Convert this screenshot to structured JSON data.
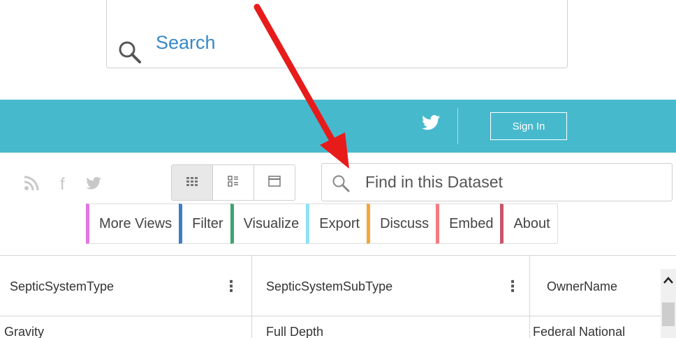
{
  "search": {
    "label": "Search"
  },
  "header": {
    "signin_label": "Sign In"
  },
  "find": {
    "label": "Find in this Dataset"
  },
  "tabs": [
    {
      "label": "More Views",
      "color": "#e276e2"
    },
    {
      "label": "Filter",
      "color": "#3a7fc5"
    },
    {
      "label": "Visualize",
      "color": "#3aa572"
    },
    {
      "label": "Export",
      "color": "#8fe1f4"
    },
    {
      "label": "Discuss",
      "color": "#f7a53b"
    },
    {
      "label": "Embed",
      "color": "#f47a82"
    },
    {
      "label": "About",
      "color": "#c7546a"
    }
  ],
  "table": {
    "columns": [
      "SepticSystemType",
      "SepticSystemSubType",
      "OwnerName"
    ],
    "rows": [
      [
        "Gravity",
        "Full Depth",
        "Federal National"
      ]
    ]
  },
  "colors": {
    "header_bar": "#47b9cd",
    "search_text": "#3a88c5",
    "arrow": "#e81b1b"
  }
}
